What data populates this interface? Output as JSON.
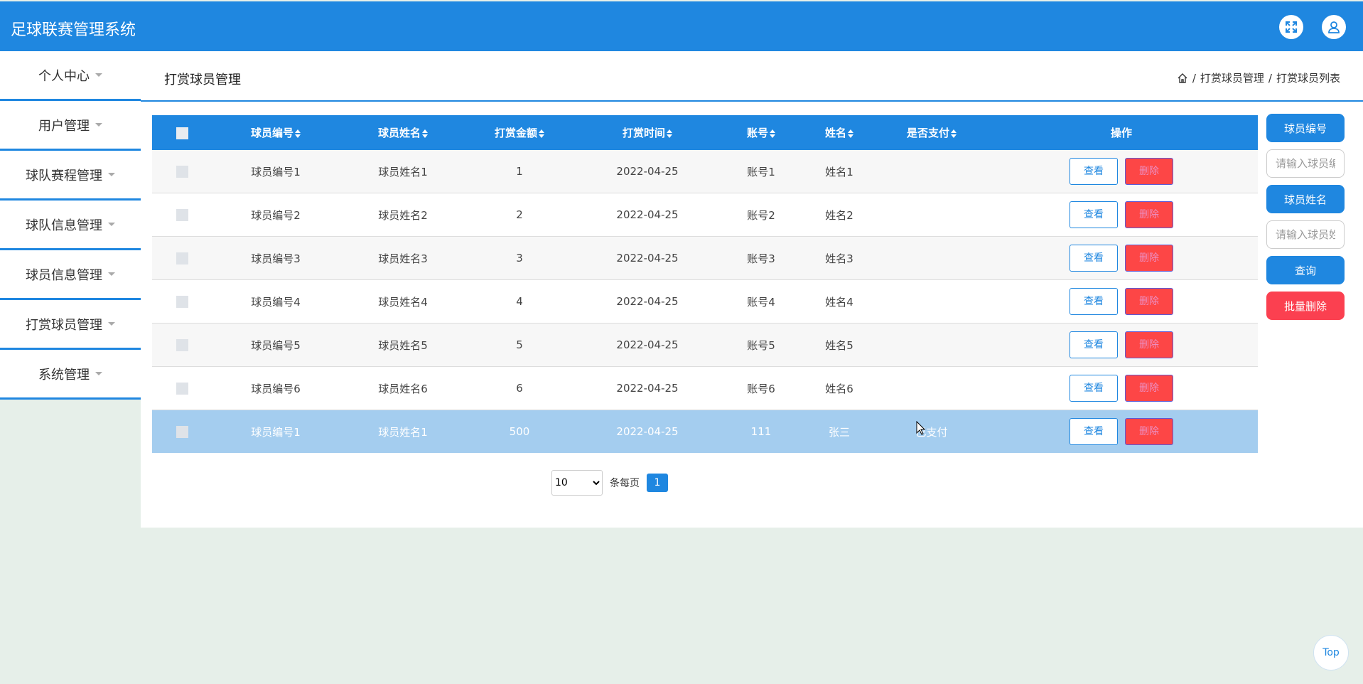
{
  "app": {
    "title": "足球联赛管理系统"
  },
  "sidebar": {
    "items": [
      {
        "label": "个人中心"
      },
      {
        "label": "用户管理"
      },
      {
        "label": "球队赛程管理"
      },
      {
        "label": "球队信息管理"
      },
      {
        "label": "球员信息管理"
      },
      {
        "label": "打赏球员管理"
      },
      {
        "label": "系统管理"
      }
    ]
  },
  "page": {
    "title": "打赏球员管理",
    "breadcrumb": [
      "打赏球员管理",
      "打赏球员列表"
    ],
    "breadcrumb_sep": "/"
  },
  "table": {
    "columns": [
      "球员编号",
      "球员姓名",
      "打赏金额",
      "打赏时间",
      "账号",
      "姓名",
      "是否支付",
      "操作"
    ],
    "rows": [
      {
        "no": "球员编号1",
        "name": "球员姓名1",
        "amount": "1",
        "time": "2022-04-25",
        "account": "账号1",
        "person": "姓名1",
        "paid": ""
      },
      {
        "no": "球员编号2",
        "name": "球员姓名2",
        "amount": "2",
        "time": "2022-04-25",
        "account": "账号2",
        "person": "姓名2",
        "paid": ""
      },
      {
        "no": "球员编号3",
        "name": "球员姓名3",
        "amount": "3",
        "time": "2022-04-25",
        "account": "账号3",
        "person": "姓名3",
        "paid": ""
      },
      {
        "no": "球员编号4",
        "name": "球员姓名4",
        "amount": "4",
        "time": "2022-04-25",
        "account": "账号4",
        "person": "姓名4",
        "paid": ""
      },
      {
        "no": "球员编号5",
        "name": "球员姓名5",
        "amount": "5",
        "time": "2022-04-25",
        "account": "账号5",
        "person": "姓名5",
        "paid": ""
      },
      {
        "no": "球员编号6",
        "name": "球员姓名6",
        "amount": "6",
        "time": "2022-04-25",
        "account": "账号6",
        "person": "姓名6",
        "paid": ""
      },
      {
        "no": "球员编号1",
        "name": "球员姓名1",
        "amount": "500",
        "time": "2022-04-25",
        "account": "111",
        "person": "张三",
        "paid": "已支付"
      }
    ],
    "view_label": "查看",
    "delete_label": "删除"
  },
  "search": {
    "player_no_label": "球员编号",
    "player_no_placeholder": "请输入球员编号",
    "player_name_label": "球员姓名",
    "player_name_placeholder": "请输入球员姓名",
    "query_label": "查询",
    "batch_delete_label": "批量删除"
  },
  "pagination": {
    "page_size": "10",
    "page_size_options": [
      "10"
    ],
    "per_page_label": "条每页",
    "current_page": "1"
  },
  "top_button": "Top",
  "colors": {
    "primary": "#1f87e0",
    "danger": "#fd4646",
    "selected_row": "#a4cdef",
    "background": "#e6efe9"
  },
  "icons": {
    "fullscreen": "expand-icon",
    "user": "user-icon",
    "home": "home-icon"
  }
}
